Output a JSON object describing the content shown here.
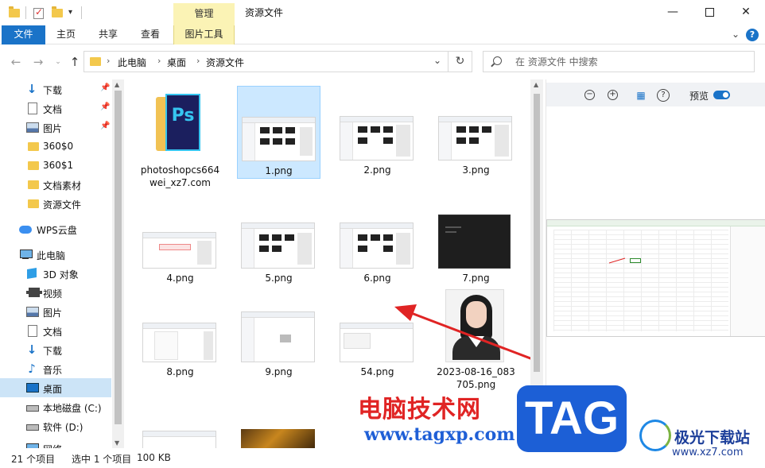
{
  "window": {
    "title": "资源文件",
    "context_tab_header": "管理"
  },
  "ribbon": {
    "tabs": [
      "文件",
      "主页",
      "共享",
      "查看",
      "图片工具"
    ],
    "help": "?"
  },
  "address": {
    "crumbs": [
      "此电脑",
      "桌面",
      "资源文件"
    ],
    "search_placeholder": "在 资源文件 中搜索"
  },
  "sidebar": {
    "quick": [
      "下载",
      "文档",
      "图片",
      "360$0",
      "360$1",
      "文档素材",
      "资源文件"
    ],
    "cloud": "WPS云盘",
    "pc": "此电脑",
    "pc_items": [
      "3D 对象",
      "视频",
      "图片",
      "文档",
      "下载",
      "音乐",
      "桌面",
      "本地磁盘 (C:)",
      "软件 (D:)",
      "网络"
    ]
  },
  "files": [
    "photoshopcs664wei_xz7.com",
    "1.png",
    "2.png",
    "3.png",
    "4.png",
    "5.png",
    "6.png",
    "7.png",
    "8.png",
    "9.png",
    "54.png",
    "2023-08-16_083705.png"
  ],
  "preview": {
    "label": "预览",
    "toggle_on": true
  },
  "status": {
    "count": "21 个项目",
    "selected": "选中 1 个项目",
    "size": "100 KB"
  },
  "watermark": {
    "cn": "电脑技术网",
    "url": "www.tagxp.com",
    "tag": "TAG",
    "jg": "极光下载站",
    "jg_url": "www.xz7.com"
  },
  "colors": {
    "accent": "#1a73c8",
    "selection": "#cce8ff",
    "context_tab": "#fbf3b5",
    "arrow": "#e02424"
  }
}
